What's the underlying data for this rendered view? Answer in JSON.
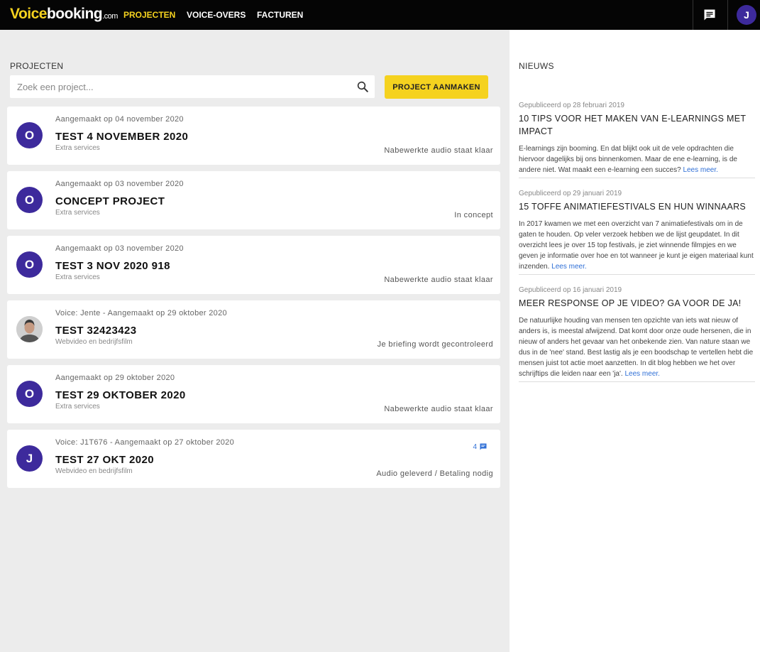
{
  "header": {
    "logo_main": "Voice",
    "logo_rest": "booking",
    "logo_suffix": ".com",
    "nav": [
      "PROJECTEN",
      "VOICE-OVERS",
      "FACTUREN"
    ],
    "user_initial": "J"
  },
  "projects": {
    "title": "PROJECTEN",
    "search_placeholder": "Zoek een project...",
    "create_label": "PROJECT AANMAKEN",
    "items": [
      {
        "avatar": "O",
        "meta": "Aangemaakt op 04 november 2020",
        "title": "TEST 4 NOVEMBER 2020",
        "sub": "Extra services",
        "status": "Nabewerkte audio staat klaar"
      },
      {
        "avatar": "O",
        "meta": "Aangemaakt op 03 november 2020",
        "title": "CONCEPT PROJECT",
        "sub": "Extra services",
        "status": "In concept"
      },
      {
        "avatar": "O",
        "meta": "Aangemaakt op 03 november 2020",
        "title": "TEST 3 NOV 2020 918",
        "sub": "Extra services",
        "status": "Nabewerkte audio staat klaar"
      },
      {
        "avatar": "",
        "meta": "Voice: Jente - Aangemaakt op 29 oktober 2020",
        "title": "TEST 32423423",
        "sub": "Webvideo en bedrijfsfilm",
        "status": "Je briefing wordt gecontroleerd"
      },
      {
        "avatar": "O",
        "meta": "Aangemaakt op 29 oktober 2020",
        "title": "TEST 29 OKTOBER 2020",
        "sub": "Extra services",
        "status": "Nabewerkte audio staat klaar"
      },
      {
        "avatar": "J",
        "meta": "Voice: J1T676 - Aangemaakt op 27 oktober 2020",
        "title": "TEST 27 OKT 2020",
        "sub": "Webvideo en bedrijfsfilm",
        "status": "Audio geleverd / Betaling nodig",
        "messages": "4"
      }
    ]
  },
  "news": {
    "title": "NIEUWS",
    "more_label": "Lees meer.",
    "items": [
      {
        "date": "Gepubliceerd op 28 februari 2019",
        "head": "10 TIPS VOOR HET MAKEN VAN E-LEARNINGS MET IMPACT",
        "body": "E-learnings zijn booming. En dat blijkt ook uit de vele opdrachten die hiervoor dagelijks bij ons binnenkomen. Maar de ene e-learning, is de andere niet. Wat maakt een e-learning een succes?"
      },
      {
        "date": "Gepubliceerd op 29 januari 2019",
        "head": "15 TOFFE ANIMATIEFESTIVALS EN HUN WINNAARS",
        "body": "In 2017 kwamen we met een overzicht van 7 animatiefestivals om in de gaten te houden. Op veler verzoek hebben we de lijst geupdatet. In dit overzicht lees je over 15 top festivals, je ziet winnende filmpjes en we geven je informatie over hoe en tot wanneer je kunt je eigen materiaal kunt inzenden."
      },
      {
        "date": "Gepubliceerd op 16 januari 2019",
        "head": "MEER RESPONSE OP JE VIDEO? GA VOOR DE JA!",
        "body": "De natuurlijke houding van mensen ten opzichte van iets wat nieuw of anders is, is meestal afwijzend. Dat komt door onze oude hersenen, die in nieuw of anders het gevaar van het onbekende zien. Van nature staan we dus in de 'nee' stand. Best lastig als je een boodschap te vertellen hebt die mensen juist tot actie moet aanzetten. In dit blog hebben we het over schrijftips die leiden naar een 'ja'."
      }
    ]
  },
  "colors": {
    "accent": "#f5d21f",
    "avatar": "#3d2a9c",
    "link": "#2f6fd6",
    "topbar": "#050505"
  }
}
